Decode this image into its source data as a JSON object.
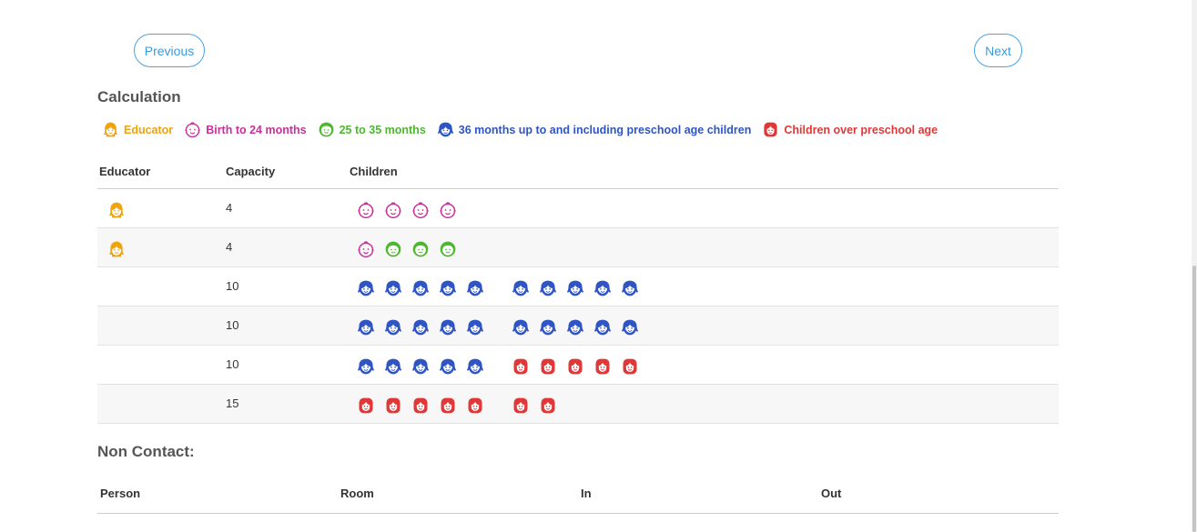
{
  "nav": {
    "previous": "Previous",
    "next": "Next"
  },
  "calculation": {
    "title": "Calculation",
    "legend": [
      {
        "key": "educator",
        "label": "Educator",
        "color": "#f0a30a",
        "icon": "educator-icon"
      },
      {
        "key": "birth24",
        "label": "Birth to 24 months",
        "color": "#c8319b",
        "icon": "baby-icon"
      },
      {
        "key": "m25_35",
        "label": "25 to 35 months",
        "color": "#4db82f",
        "icon": "toddler-icon"
      },
      {
        "key": "preschool",
        "label": "36 months up to and including preschool age children",
        "color": "#2f55c4",
        "icon": "preschool-child-icon"
      },
      {
        "key": "overpreschool",
        "label": "Children over preschool age",
        "color": "#e03838",
        "icon": "school-child-icon"
      }
    ],
    "headers": {
      "educator": "Educator",
      "capacity": "Capacity",
      "children": "Children"
    },
    "rows": [
      {
        "educator": true,
        "capacity": "4",
        "children": [
          [
            "birth24",
            "birth24",
            "birth24",
            "birth24"
          ]
        ]
      },
      {
        "educator": true,
        "capacity": "4",
        "children": [
          [
            "birth24",
            "m25_35",
            "m25_35",
            "m25_35"
          ]
        ]
      },
      {
        "educator": false,
        "capacity": "10",
        "children": [
          [
            "preschool",
            "preschool",
            "preschool",
            "preschool",
            "preschool"
          ],
          [
            "preschool",
            "preschool",
            "preschool",
            "preschool",
            "preschool"
          ]
        ]
      },
      {
        "educator": false,
        "capacity": "10",
        "children": [
          [
            "preschool",
            "preschool",
            "preschool",
            "preschool",
            "preschool"
          ],
          [
            "preschool",
            "preschool",
            "preschool",
            "preschool",
            "preschool"
          ]
        ]
      },
      {
        "educator": false,
        "capacity": "10",
        "children": [
          [
            "preschool",
            "preschool",
            "preschool",
            "preschool",
            "preschool"
          ],
          [
            "overpreschool",
            "overpreschool",
            "overpreschool",
            "overpreschool",
            "overpreschool"
          ]
        ]
      },
      {
        "educator": false,
        "capacity": "15",
        "children": [
          [
            "overpreschool",
            "overpreschool",
            "overpreschool",
            "overpreschool",
            "overpreschool"
          ],
          [
            "overpreschool",
            "overpreschool"
          ]
        ]
      }
    ]
  },
  "non_contact": {
    "title": "Non Contact:",
    "headers": [
      "Person",
      "Room",
      "In",
      "Out"
    ]
  }
}
